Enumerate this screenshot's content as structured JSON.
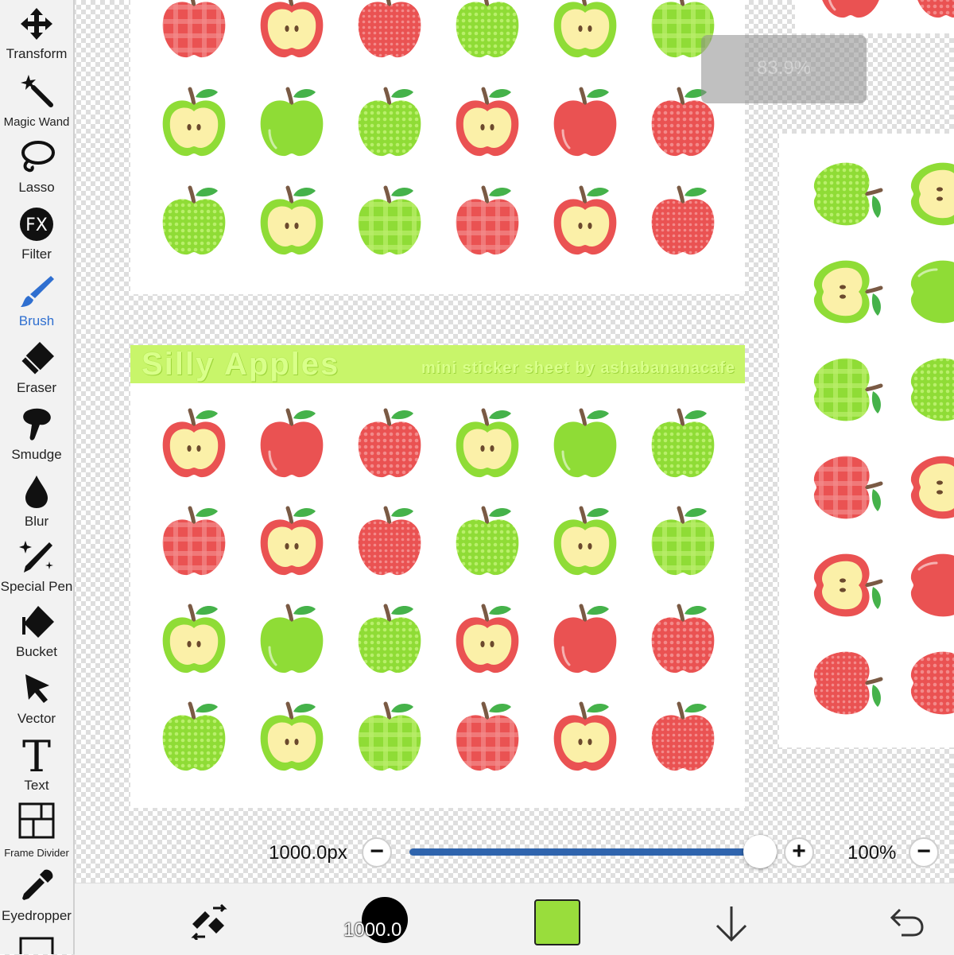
{
  "toolbar": {
    "tools": [
      {
        "label": "Transform",
        "icon": "move-arrows-icon"
      },
      {
        "label": "Magic Wand",
        "icon": "magic-wand-icon"
      },
      {
        "label": "Lasso",
        "icon": "lasso-icon"
      },
      {
        "label": "Filter",
        "icon": "fx-icon",
        "icon_text": "FX"
      },
      {
        "label": "Brush",
        "icon": "brush-icon",
        "active": true
      },
      {
        "label": "Eraser",
        "icon": "eraser-icon"
      },
      {
        "label": "Smudge",
        "icon": "smudge-icon"
      },
      {
        "label": "Blur",
        "icon": "drop-icon"
      },
      {
        "label": "Special Pen",
        "icon": "special-pen-icon"
      },
      {
        "label": "Bucket",
        "icon": "bucket-icon"
      },
      {
        "label": "Vector",
        "icon": "cursor-arrow-icon"
      },
      {
        "label": "Text",
        "icon": "text-t-icon",
        "icon_text": "T"
      },
      {
        "label": "Frame Divider",
        "icon": "frame-divider-icon"
      },
      {
        "label": "Eyedropper",
        "icon": "eyedropper-icon"
      }
    ],
    "active_color": "#2f6fd0"
  },
  "canvas": {
    "zoom_indicator": "83.9%",
    "sheet_title": "Silly Apples",
    "sheet_subtitle": "mini sticker sheet by ashabananacafe",
    "title_bar_color": "#c8f56a"
  },
  "brush_controls": {
    "size_value": "1000.0px",
    "size_fraction": 1.0,
    "opacity_value": "100%",
    "minus_label": "−",
    "plus_label": "+"
  },
  "bottom_bar": {
    "brush_size_preview": "1000.0",
    "current_color": "#99dd3c",
    "icons": [
      "swap-tools-icon",
      "brush-preview",
      "color-swatch",
      "download-arrow-icon",
      "undo-icon"
    ]
  },
  "colors": {
    "apple_red": "#ea5252",
    "apple_green": "#8fdc36",
    "apple_flesh": "#fbf0a8",
    "slider": "#2f64ad"
  }
}
